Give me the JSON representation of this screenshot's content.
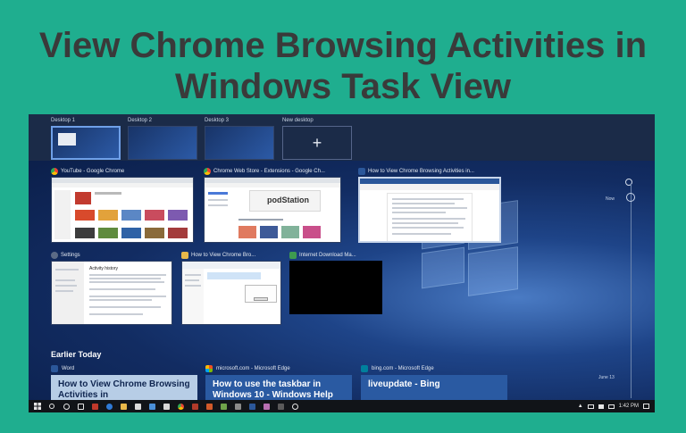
{
  "headline": "View Chrome Browsing Activities in Windows Task View",
  "desktops": [
    {
      "label": "Desktop 1",
      "active": true
    },
    {
      "label": "Desktop 2"
    },
    {
      "label": "Desktop 3"
    },
    {
      "label": "New desktop",
      "symbol": "+"
    }
  ],
  "windows": [
    {
      "title": "YouTube - Google Chrome",
      "icon": "chrome-icon"
    },
    {
      "title": "Chrome Web Store - Extensions - Google Ch...",
      "icon": "chrome-icon",
      "content_text": "podStation"
    },
    {
      "title": "How to View Chrome Browsing Activities in...",
      "icon": "word-icon"
    },
    {
      "title": "Settings",
      "icon": "gear-icon",
      "content_text": "Activity history"
    },
    {
      "title": "How to View Chrome Bro...",
      "icon": "folder-icon"
    },
    {
      "title": "Internet Download Ma...",
      "icon": "idm-icon"
    }
  ],
  "timeline": {
    "top_label": "Now",
    "bottom_label": "June 13"
  },
  "section_label": "Earlier Today",
  "activity_cards": [
    {
      "app": "Word",
      "icon": "word-icon",
      "title": "How to View Chrome Browsing Activities in"
    },
    {
      "app": "microsoft.com - Microsoft Edge",
      "icon": "edge-icon",
      "title": "How to use the taskbar in Windows 10 - Windows Help"
    },
    {
      "app": "bing.com - Microsoft Edge",
      "icon": "bing-icon",
      "title": "liveupdate - Bing"
    }
  ],
  "taskbar": {
    "time": "1:42 PM"
  },
  "colors": {
    "background": "#1fae8f",
    "headline": "#3a3a3a",
    "taskview": "#0f2550",
    "card": "#b7cde6"
  }
}
